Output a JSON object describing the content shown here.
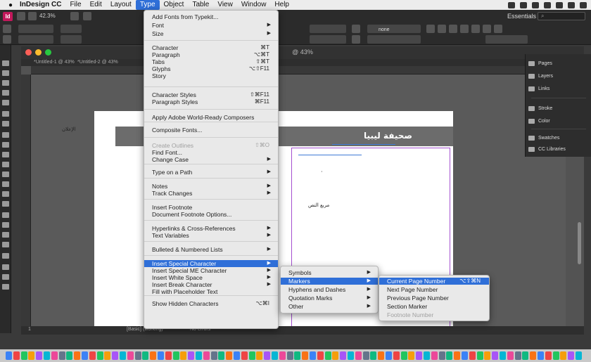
{
  "menubar": {
    "app": "InDesign CC",
    "items": [
      "File",
      "Edit",
      "Layout",
      "Type",
      "Object",
      "Table",
      "View",
      "Window",
      "Help"
    ],
    "active": "Type"
  },
  "controlbar": {
    "zoom": "42.3%",
    "workspace": "Essentials",
    "font_name": "none"
  },
  "document": {
    "title": "@ 43%",
    "tabs": [
      "*Untitled-1 @ 43%",
      "*Untitled-2 @ 43%"
    ],
    "masthead_title": "صحيفة ليبيا",
    "left_text": "الإعلان",
    "column_text": "مربع النص"
  },
  "panels": {
    "items": [
      {
        "label": "Pages",
        "icon": "pages-icon"
      },
      {
        "label": "Layers",
        "icon": "layers-icon"
      },
      {
        "label": "Links",
        "icon": "links-icon"
      },
      {
        "label": "Stroke",
        "icon": "stroke-icon"
      },
      {
        "label": "Color",
        "icon": "color-icon"
      },
      {
        "label": "Swatches",
        "icon": "swatches-icon"
      },
      {
        "label": "CC Libraries",
        "icon": "cc-libraries-icon"
      }
    ]
  },
  "type_menu": {
    "items": [
      {
        "label": "Add Fonts from Typekit...",
        "shortcut": "",
        "submenu": false,
        "disabled": false
      },
      {
        "label": "Font",
        "shortcut": "",
        "submenu": true,
        "disabled": false
      },
      {
        "label": "Size",
        "shortcut": "",
        "submenu": true,
        "disabled": false
      },
      {
        "label": "Character",
        "shortcut": "⌘T",
        "submenu": false,
        "disabled": false
      },
      {
        "label": "Paragraph",
        "shortcut": "⌥⌘T",
        "submenu": false,
        "disabled": false
      },
      {
        "label": "Tabs",
        "shortcut": "⇧⌘T",
        "submenu": false,
        "disabled": false
      },
      {
        "label": "Glyphs",
        "shortcut": "⌥⇧F11",
        "submenu": false,
        "disabled": false
      },
      {
        "label": "Story",
        "shortcut": "",
        "submenu": false,
        "disabled": false
      },
      {
        "label": "Character Styles",
        "shortcut": "⇧⌘F11",
        "submenu": false,
        "disabled": false
      },
      {
        "label": "Paragraph Styles",
        "shortcut": "⌘F11",
        "submenu": false,
        "disabled": false
      },
      {
        "label": "Apply Adobe World-Ready Composers",
        "shortcut": "",
        "submenu": false,
        "disabled": false
      },
      {
        "label": "Composite Fonts...",
        "shortcut": "",
        "submenu": false,
        "disabled": false
      },
      {
        "label": "Create Outlines",
        "shortcut": "⇧⌘O",
        "submenu": false,
        "disabled": true
      },
      {
        "label": "Find Font...",
        "shortcut": "",
        "submenu": false,
        "disabled": false
      },
      {
        "label": "Change Case",
        "shortcut": "",
        "submenu": true,
        "disabled": false
      },
      {
        "label": "Type on a Path",
        "shortcut": "",
        "submenu": true,
        "disabled": false
      },
      {
        "label": "Notes",
        "shortcut": "",
        "submenu": true,
        "disabled": false
      },
      {
        "label": "Track Changes",
        "shortcut": "",
        "submenu": true,
        "disabled": false
      },
      {
        "label": "Insert Footnote",
        "shortcut": "",
        "submenu": false,
        "disabled": false
      },
      {
        "label": "Document Footnote Options...",
        "shortcut": "",
        "submenu": false,
        "disabled": false
      },
      {
        "label": "Hyperlinks & Cross-References",
        "shortcut": "",
        "submenu": true,
        "disabled": false
      },
      {
        "label": "Text Variables",
        "shortcut": "",
        "submenu": true,
        "disabled": false
      },
      {
        "label": "Bulleted & Numbered Lists",
        "shortcut": "",
        "submenu": true,
        "disabled": false
      },
      {
        "label": "Insert Special Character",
        "shortcut": "",
        "submenu": true,
        "disabled": false,
        "highlighted": true
      },
      {
        "label": "Insert Special ME Character",
        "shortcut": "",
        "submenu": true,
        "disabled": false
      },
      {
        "label": "Insert White Space",
        "shortcut": "",
        "submenu": true,
        "disabled": false
      },
      {
        "label": "Insert Break Character",
        "shortcut": "",
        "submenu": true,
        "disabled": false
      },
      {
        "label": "Fill with Placeholder Text",
        "shortcut": "",
        "submenu": false,
        "disabled": false
      },
      {
        "label": "Show Hidden Characters",
        "shortcut": "⌥⌘I",
        "submenu": false,
        "disabled": false
      }
    ]
  },
  "special_char_menu": {
    "items": [
      {
        "label": "Symbols",
        "submenu": true
      },
      {
        "label": "Markers",
        "submenu": true,
        "highlighted": true
      },
      {
        "label": "Hyphens and Dashes",
        "submenu": true
      },
      {
        "label": "Quotation Marks",
        "submenu": true
      },
      {
        "label": "Other",
        "submenu": true
      }
    ]
  },
  "markers_menu": {
    "items": [
      {
        "label": "Current Page Number",
        "shortcut": "⌥⇧⌘N",
        "highlighted": true,
        "disabled": false
      },
      {
        "label": "Next Page Number",
        "shortcut": "",
        "highlighted": false,
        "disabled": false
      },
      {
        "label": "Previous Page Number",
        "shortcut": "",
        "highlighted": false,
        "disabled": false
      },
      {
        "label": "Section Marker",
        "shortcut": "",
        "highlighted": false,
        "disabled": false
      },
      {
        "label": "Footnote Number",
        "shortcut": "",
        "highlighted": false,
        "disabled": true
      }
    ]
  },
  "status": {
    "page": "1",
    "style": "[Basic] (working)",
    "errors": "No errors"
  }
}
